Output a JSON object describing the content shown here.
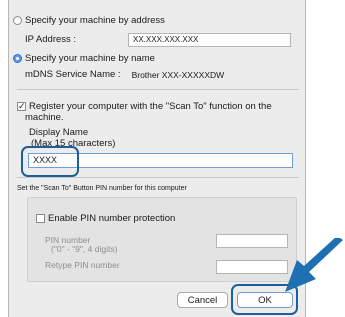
{
  "dialog": {
    "by_address": {
      "label": "Specify your machine by address",
      "ip_label": "IP Address :",
      "ip_value": "XX.XXX.XXX.XXX"
    },
    "by_name": {
      "label": "Specify your machine by name",
      "mdns_label": "mDNS Service Name :",
      "mdns_value": "Brother XXX-XXXXXDW"
    },
    "register": {
      "checkbox_label_line1": "Register your computer with the \"Scan To\" function on the",
      "checkbox_label_line2": "machine.",
      "display_name_label": "Display Name",
      "display_name_hint": "(Max 15 characters)",
      "display_name_value": "XXXX"
    },
    "pin": {
      "section_title": "Set the \"Scan To\" Button PIN number for this computer",
      "enable_label": "Enable PIN number protection",
      "pin_label_line1": "PIN number",
      "pin_label_line2": "(\"0\" - \"9\", 4 digits)",
      "retype_label": "Retype PIN number",
      "pin_value": "",
      "retype_value": ""
    },
    "buttons": {
      "cancel": "Cancel",
      "ok": "OK"
    }
  },
  "colors": {
    "highlight": "#1d5f9c",
    "arrow": "#1f6fb3"
  }
}
